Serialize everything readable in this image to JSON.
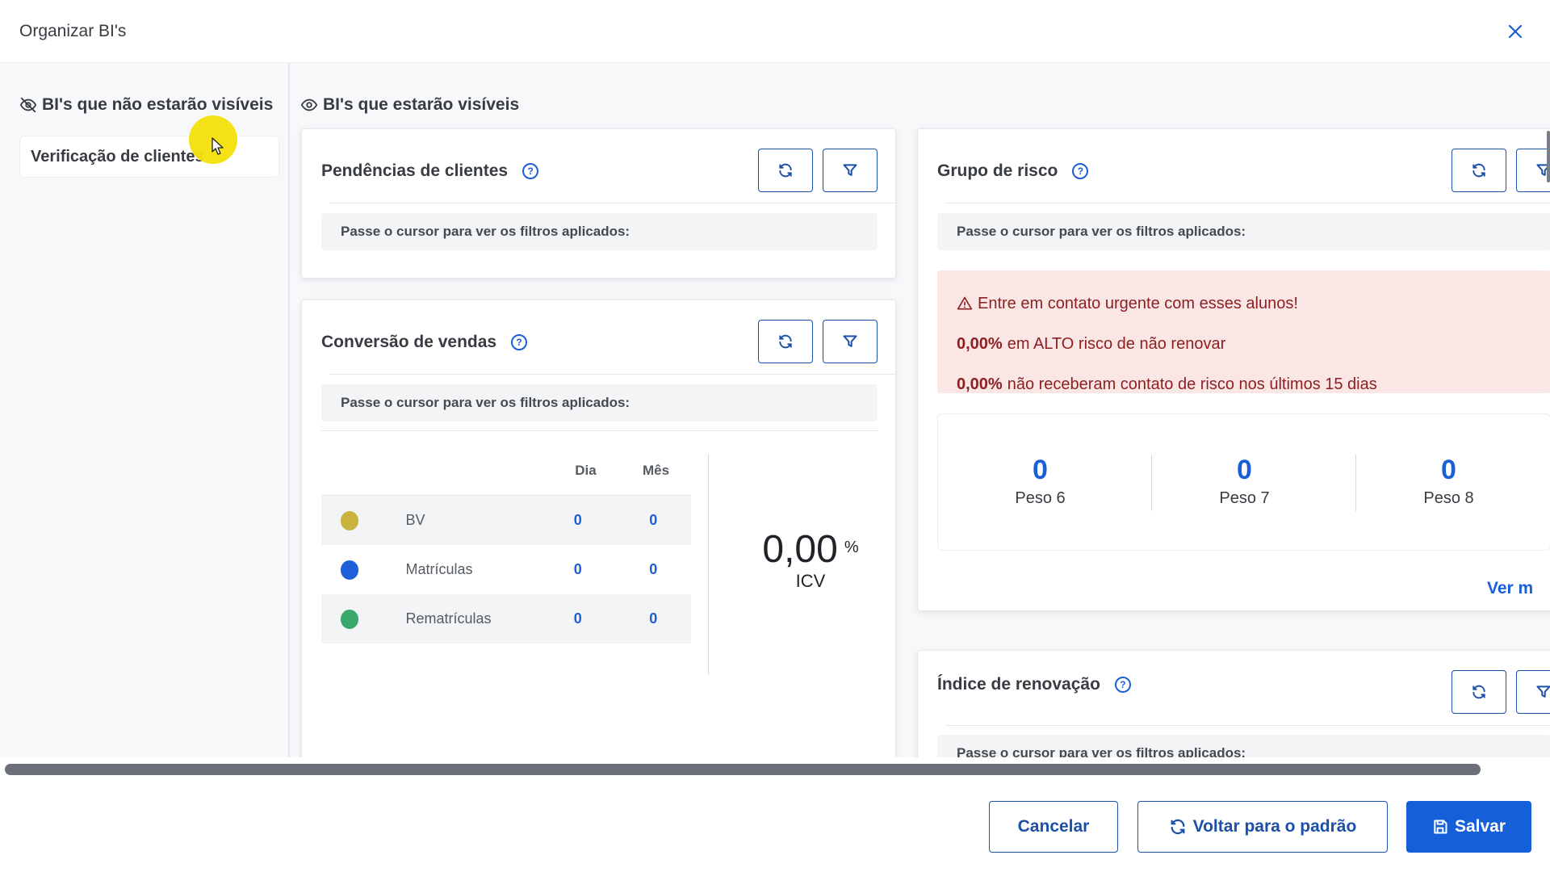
{
  "modal": {
    "title": "Organizar BI's"
  },
  "hidden_section": {
    "title": "BI's que não estarão visíveis",
    "items": [
      "Verificação de clientes"
    ]
  },
  "visible_section": {
    "title": "BI's que estarão visíveis"
  },
  "filter_hint": "Passe o cursor para ver os filtros aplicados:",
  "cards": {
    "pendencias": {
      "title": "Pendências de clientes"
    },
    "conversao": {
      "title": "Conversão de vendas",
      "columns": [
        "Dia",
        "Mês"
      ],
      "rows": [
        {
          "label": "BV",
          "color": "#c9b33e",
          "dia": "0",
          "mes": "0"
        },
        {
          "label": "Matrículas",
          "color": "#1d5fd8",
          "dia": "0",
          "mes": "0"
        },
        {
          "label": "Rematrículas",
          "color": "#3ba86b",
          "dia": "0",
          "mes": "0"
        }
      ],
      "icv_value": "0,00",
      "icv_unit": "%",
      "icv_label": "ICV"
    },
    "grupo_risco": {
      "title": "Grupo de risco",
      "alert_title": "Entre em contato urgente com esses alunos!",
      "alert_line1_value": "0,00%",
      "alert_line1_text": "em ALTO risco de não renovar",
      "alert_line2_value": "0,00%",
      "alert_line2_text": "não receberam contato de risco nos últimos 15 dias",
      "pesos": [
        {
          "value": "0",
          "label": "Peso 6"
        },
        {
          "value": "0",
          "label": "Peso 7"
        },
        {
          "value": "0",
          "label": "Peso 8"
        }
      ],
      "ver_mais": "Ver m"
    },
    "indice_renovacao": {
      "title": "Índice de renovação"
    }
  },
  "footer": {
    "cancel": "Cancelar",
    "reset": "Voltar para o padrão",
    "save": "Salvar"
  },
  "colors": {
    "primary": "#1560d8",
    "alert_bg": "#fbe6e6",
    "alert_text": "#8c1f1f"
  }
}
